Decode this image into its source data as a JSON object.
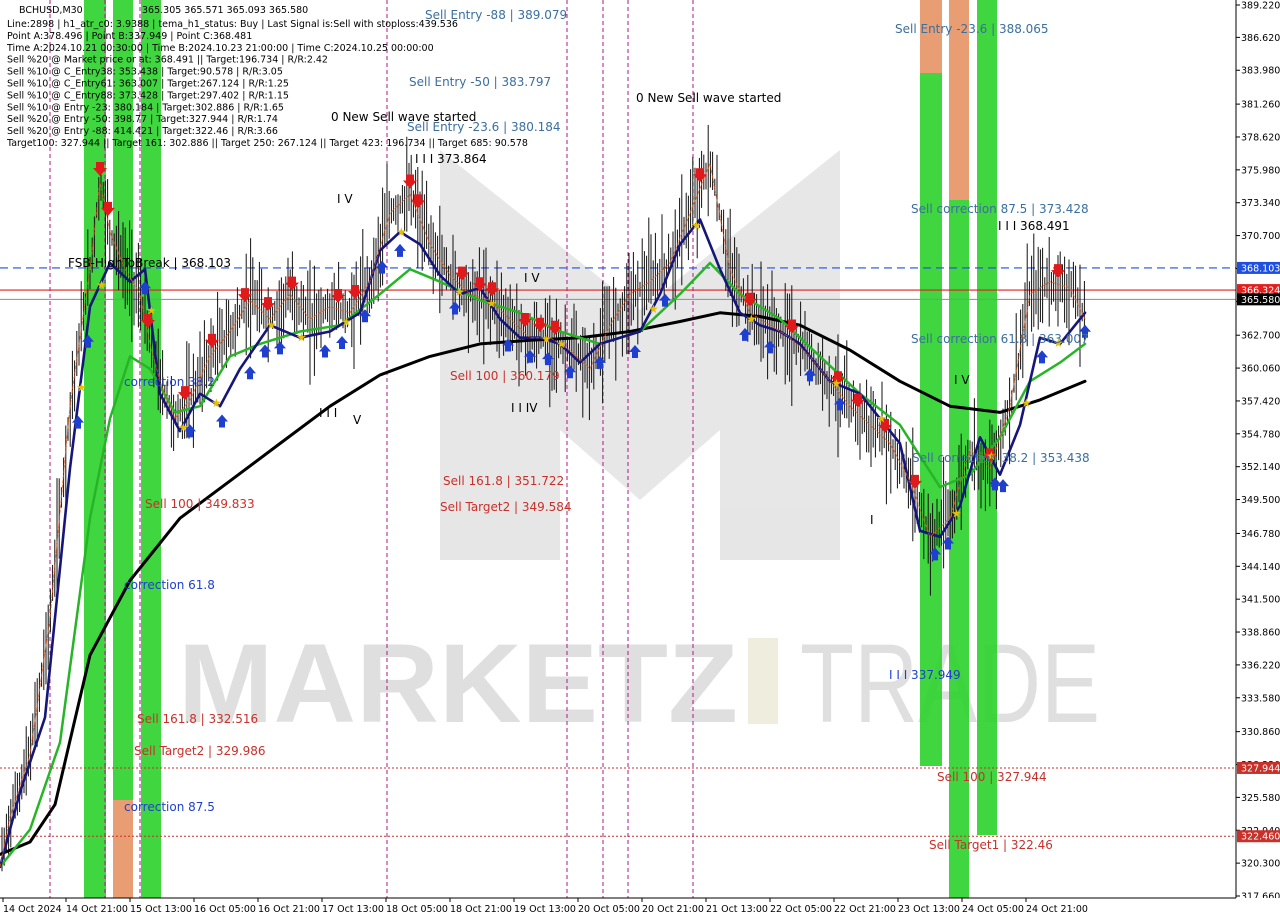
{
  "chart_data": {
    "type": "line",
    "symbol": "BCHUSD,M30",
    "header_ohlc": "365.305 365.571 365.093 365.580",
    "info_lines": [
      "Line:2898 | h1_atr_c0: 3.9388 | tema_h1_status: Buy | Last Signal is:Sell with stoploss:439.536",
      "Point A:378.496 | Point B:337.949 | Point C:368.481",
      "Time A:2024.10.21 00:30:00 | Time B:2024.10.23 21:00:00 | Time C:2024.10.25 00:00:00",
      "Sell %20 @ Market price or at: 368.491 || Target:196.734 | R/R:2.42",
      "Sell %10 @ C_Entry38: 353.438 | Target:90.578 | R/R:3.05",
      "Sell %10 @ C_Entry61: 363.007 | Target:267.124 | R/R:1.25",
      "Sell %10 @ C_Entry88: 373.428 | Target:297.402 | R/R:1.15",
      "Sell %10 @ Entry -23: 380.184 | Target:302.886 | R/R:1.65",
      "Sell %20 @ Entry -50: 398.77 | Target:327.944 | R/R:1.74",
      "Sell %20 @ Entry -88: 414.421 | Target:322.46 | R/R:3.66",
      "Target100: 327.944 || Target 161: 302.886 || Target 250: 267.124 || Target 423: 196.734 || Target 685: 90.578"
    ],
    "y_axis": {
      "min": 317.66,
      "max": 389.22,
      "ticks": [
        "389.220",
        "386.620",
        "383.980",
        "381.260",
        "378.620",
        "375.980",
        "373.340",
        "370.700",
        "368.060",
        "365.420",
        "362.700",
        "360.060",
        "357.420",
        "354.780",
        "352.140",
        "349.500",
        "346.780",
        "344.140",
        "341.500",
        "338.860",
        "336.220",
        "333.580",
        "330.860",
        "328.220",
        "325.580",
        "322.940",
        "320.300",
        "317.660"
      ]
    },
    "x_axis": {
      "ticks": [
        "14 Oct 2024",
        "14 Oct 21:00",
        "15 Oct 13:00",
        "16 Oct 05:00",
        "16 Oct 21:00",
        "17 Oct 13:00",
        "18 Oct 05:00",
        "18 Oct 21:00",
        "19 Oct 13:00",
        "20 Oct 05:00",
        "20 Oct 21:00",
        "21 Oct 13:00",
        "22 Oct 05:00",
        "22 Oct 21:00",
        "23 Oct 13:00",
        "24 Oct 05:00",
        "24 Oct 21:00"
      ]
    },
    "price_badges": [
      {
        "value": "368.103",
        "color": "#1f4fe0"
      },
      {
        "value": "366.324",
        "color": "#e01f1f"
      },
      {
        "value": "365.580",
        "color": "#000000"
      },
      {
        "value": "327.944",
        "color": "#c8302a"
      },
      {
        "value": "322.460",
        "color": "#c8302a"
      }
    ],
    "annotations": [
      {
        "text": "Sell Entry -88 | 389.079",
        "color": "#3a6fa0"
      },
      {
        "text": "Sell Entry -50 | 383.797",
        "color": "#3a6fa0"
      },
      {
        "text": "Sell Entry -23.6 | 380.184",
        "color": "#3a6fa0"
      },
      {
        "text": "0 New Sell wave started",
        "color": "#000000"
      },
      {
        "text": "0 New Sell wave started",
        "color": "#000000"
      },
      {
        "text": "I I I 373.864",
        "color": "#000000"
      },
      {
        "text": "I V",
        "color": "#000000"
      },
      {
        "text": "I V",
        "color": "#000000"
      },
      {
        "text": "I I I",
        "color": "#000000"
      },
      {
        "text": "V",
        "color": "#000000"
      },
      {
        "text": "I I IV",
        "color": "#000000"
      },
      {
        "text": "FSB-HighToBreak | 368.103",
        "color": "#000000"
      },
      {
        "text": "Sell 100 | 360.179",
        "color": "#c8302a"
      },
      {
        "text": "Sell 161.8 | 351.722",
        "color": "#c8302a"
      },
      {
        "text": "Sell Target2 | 349.584",
        "color": "#c8302a"
      },
      {
        "text": "Sell 100 | 349.833",
        "color": "#c8302a"
      },
      {
        "text": "correction 38.2",
        "color": "#1f3fd0"
      },
      {
        "text": "correction 61.8",
        "color": "#1f3fd0"
      },
      {
        "text": "correction 87.5",
        "color": "#1f3fd0"
      },
      {
        "text": "Sell 161.8 | 332.516",
        "color": "#c8302a"
      },
      {
        "text": "Sell Target2 | 329.986",
        "color": "#c8302a"
      },
      {
        "text": "Sell Entry -23.6 | 388.065",
        "color": "#3a6fa0"
      },
      {
        "text": "Sell correction 87.5 | 373.428",
        "color": "#3a6fa0"
      },
      {
        "text": "I I I 368.491",
        "color": "#000000"
      },
      {
        "text": "Sell correction 61.8 | 363.007",
        "color": "#3a6fa0"
      },
      {
        "text": "Sell correction 38.2 | 353.438",
        "color": "#3a6fa0"
      },
      {
        "text": "I V",
        "color": "#000000"
      },
      {
        "text": "I",
        "color": "#000000"
      },
      {
        "text": "I I I 337.949",
        "color": "#1f3fd0"
      },
      {
        "text": "Sell 100 | 327.944",
        "color": "#c8302a"
      },
      {
        "text": "Sell Target1 | 322.46",
        "color": "#c8302a"
      }
    ],
    "series": [
      {
        "name": "",
        "color": "#000000",
        "kind": "slow-ma",
        "x": [
          0,
          30,
          55,
          90,
          130,
          180,
          230,
          280,
          330,
          380,
          430,
          480,
          530,
          580,
          630,
          680,
          720,
          760,
          800,
          850,
          900,
          950,
          1000,
          1040,
          1085
        ],
        "y": [
          321.0,
          322.0,
          325.0,
          337.0,
          343.0,
          348.0,
          351.0,
          354.0,
          357.0,
          359.5,
          361.0,
          362.0,
          362.3,
          362.5,
          363.0,
          363.8,
          364.5,
          364.2,
          363.5,
          361.5,
          359.0,
          357.0,
          356.5,
          357.5,
          359.0
        ]
      },
      {
        "name": "",
        "color": "#27b527",
        "kind": "mid-ma",
        "x": [
          0,
          30,
          60,
          90,
          110,
          130,
          150,
          175,
          200,
          230,
          260,
          300,
          340,
          380,
          410,
          440,
          480,
          520,
          560,
          600,
          640,
          680,
          710,
          740,
          780,
          820,
          860,
          900,
          940,
          970,
          1000,
          1030,
          1060,
          1085
        ],
        "y": [
          320.0,
          323.0,
          330.0,
          348.0,
          356.0,
          361.0,
          360.0,
          356.5,
          357.0,
          361.0,
          362.0,
          363.0,
          363.5,
          366.0,
          368.0,
          367.0,
          365.5,
          364.5,
          363.0,
          362.0,
          363.0,
          366.0,
          368.5,
          366.0,
          364.0,
          361.0,
          358.0,
          355.5,
          350.5,
          351.5,
          354.5,
          359.0,
          360.5,
          362.0
        ]
      },
      {
        "name": "",
        "color": "#16167a",
        "kind": "fast-ma",
        "x": [
          0,
          20,
          45,
          70,
          90,
          110,
          130,
          145,
          160,
          180,
          200,
          220,
          240,
          270,
          300,
          330,
          360,
          380,
          400,
          420,
          440,
          460,
          480,
          500,
          520,
          540,
          560,
          580,
          600,
          620,
          640,
          660,
          680,
          700,
          720,
          740,
          760,
          780,
          800,
          830,
          860,
          880,
          900,
          920,
          940,
          960,
          980,
          1000,
          1020,
          1040,
          1060,
          1085
        ],
        "y": [
          320.0,
          326.0,
          332.0,
          352.0,
          365.0,
          368.5,
          367.0,
          368.0,
          358.0,
          355.0,
          358.0,
          357.0,
          360.0,
          363.5,
          362.5,
          363.0,
          364.5,
          369.5,
          371.0,
          370.0,
          367.5,
          366.0,
          366.5,
          364.0,
          362.5,
          362.5,
          362.0,
          360.5,
          362.0,
          362.5,
          363.0,
          366.0,
          370.0,
          372.0,
          368.0,
          364.5,
          363.5,
          363.0,
          362.0,
          359.0,
          358.0,
          356.0,
          354.0,
          347.0,
          346.5,
          349.0,
          354.5,
          351.5,
          355.5,
          362.5,
          362.0,
          364.5
        ]
      },
      {
        "name": "",
        "color": "#e05a1a",
        "kind": "price-envelope",
        "x": [
          0,
          10,
          30,
          50,
          70,
          90,
          100,
          110,
          125,
          140,
          150,
          160,
          175,
          190,
          210,
          230,
          250,
          270,
          290,
          310,
          330,
          350,
          370,
          390,
          410,
          430,
          450,
          470,
          490,
          510,
          530,
          550,
          570,
          590,
          610,
          630,
          650,
          670,
          690,
          710,
          730,
          750,
          770,
          790,
          810,
          830,
          850,
          870,
          890,
          910,
          930,
          950,
          970,
          990,
          1010,
          1030,
          1050,
          1070,
          1085
        ],
        "y": [
          320.0,
          324.0,
          329.0,
          340.0,
          357.0,
          368.0,
          375.0,
          371.0,
          368.0,
          366.0,
          362.0,
          359.0,
          356.0,
          357.5,
          361.0,
          363.0,
          365.5,
          364.0,
          366.0,
          364.0,
          365.0,
          364.5,
          367.0,
          372.5,
          374.0,
          370.0,
          367.5,
          366.0,
          365.5,
          364.0,
          362.5,
          362.5,
          361.5,
          360.0,
          363.5,
          366.0,
          367.0,
          368.5,
          372.5,
          376.5,
          368.0,
          364.5,
          363.5,
          362.5,
          361.0,
          359.0,
          357.0,
          355.5,
          354.0,
          351.0,
          346.5,
          348.0,
          353.5,
          352.0,
          357.0,
          366.0,
          367.0,
          366.5,
          364.0
        ]
      }
    ]
  },
  "watermark": {
    "brand_left": "MARKETZ",
    "brand_right": "TRADE"
  }
}
